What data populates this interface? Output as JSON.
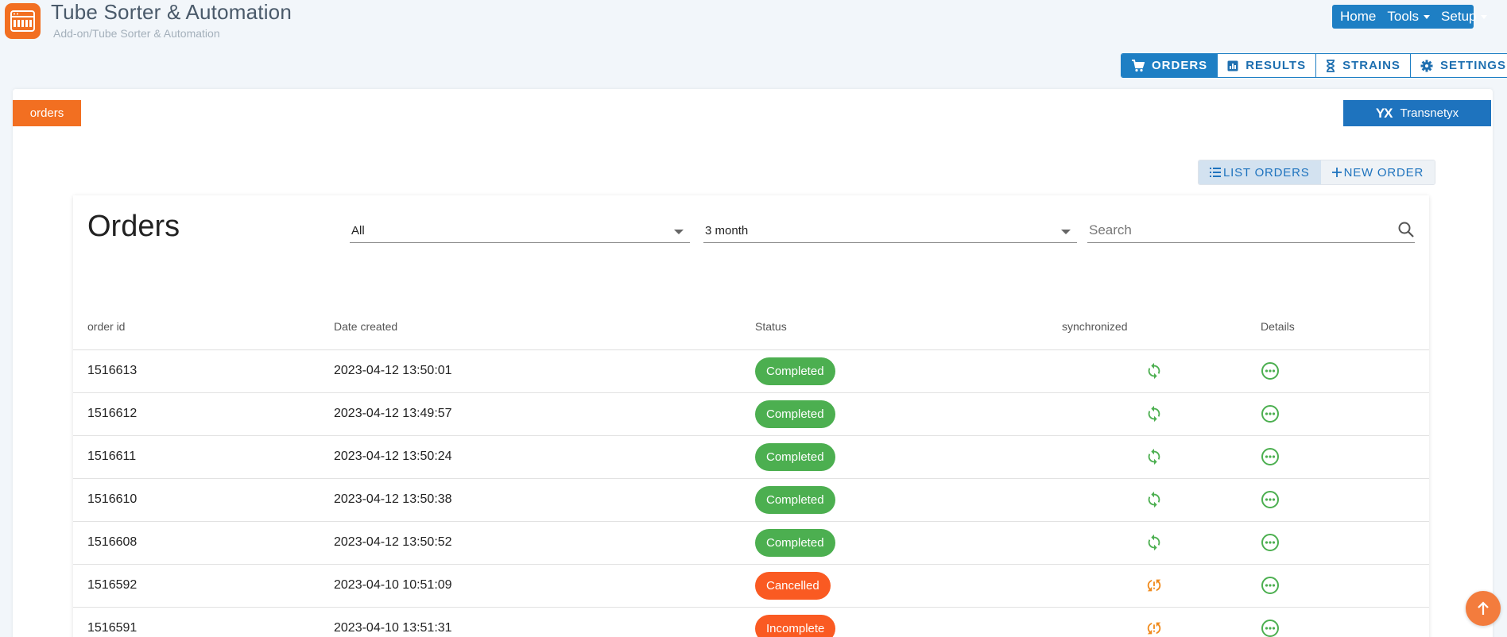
{
  "app": {
    "title": "Tube Sorter & Automation",
    "breadcrumb": "Add-on/Tube Sorter & Automation",
    "logo_icon": "tube-rack-icon"
  },
  "topnav": {
    "home": "Home",
    "tools": "Tools",
    "setup": "Setup"
  },
  "tabs": {
    "orders": "ORDERS",
    "results": "RESULTS",
    "strains": "STRAINS",
    "settings": "SETTINGS",
    "active": "ORDERS"
  },
  "section_chip": "orders",
  "brand_chip": {
    "logo": "YX",
    "label": "Transnetyx"
  },
  "view_toggle": {
    "list": "LIST ORDERS",
    "new": "NEW ORDER"
  },
  "orders": {
    "heading": "Orders",
    "filter_status": "All",
    "filter_period": "3 month",
    "search_placeholder": "Search",
    "columns": {
      "id": "order id",
      "date": "Date created",
      "status": "Status",
      "sync": "synchronized",
      "details": "Details"
    },
    "rows": [
      {
        "id": "1516613",
        "date": "2023-04-12 13:50:01",
        "status": "Completed",
        "synced": true
      },
      {
        "id": "1516612",
        "date": "2023-04-12 13:49:57",
        "status": "Completed",
        "synced": true
      },
      {
        "id": "1516611",
        "date": "2023-04-12 13:50:24",
        "status": "Completed",
        "synced": true
      },
      {
        "id": "1516610",
        "date": "2023-04-12 13:50:38",
        "status": "Completed",
        "synced": true
      },
      {
        "id": "1516608",
        "date": "2023-04-12 13:50:52",
        "status": "Completed",
        "synced": true
      },
      {
        "id": "1516592",
        "date": "2023-04-10 10:51:09",
        "status": "Cancelled",
        "synced": false
      },
      {
        "id": "1516591",
        "date": "2023-04-10 13:51:31",
        "status": "Incomplete",
        "synced": false
      }
    ]
  },
  "colors": {
    "primary": "#1e7fc4",
    "accent": "#f26f21",
    "status_ok": "#4caf50",
    "status_bad": "#fa5a22",
    "sync_ok": "#4caf50",
    "sync_bad": "#f08a1c"
  }
}
